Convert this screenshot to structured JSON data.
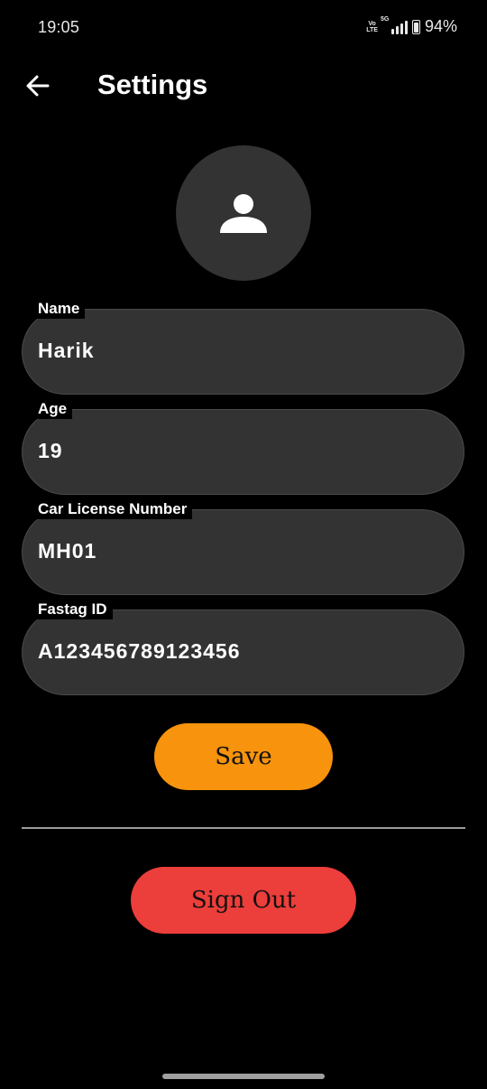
{
  "status_bar": {
    "time": "19:05",
    "volte_top": "Vo",
    "volte_bottom": "LTE",
    "network_type": "5G",
    "battery_percent": "94%"
  },
  "app_bar": {
    "back_icon": "arrow-left-icon",
    "title": "Settings"
  },
  "profile": {
    "avatar_icon": "person-icon"
  },
  "form": {
    "fields": [
      {
        "label": "Name",
        "value": "Harik"
      },
      {
        "label": "Age",
        "value": "19"
      },
      {
        "label": "Car License Number",
        "value": "MH01"
      },
      {
        "label": "Fastag ID",
        "value": "A123456789123456"
      }
    ]
  },
  "actions": {
    "save_label": "Save",
    "signout_label": "Sign Out"
  },
  "colors": {
    "background": "#000000",
    "surface": "#333333",
    "save": "#f7930c",
    "signout": "#ec3e3a"
  }
}
